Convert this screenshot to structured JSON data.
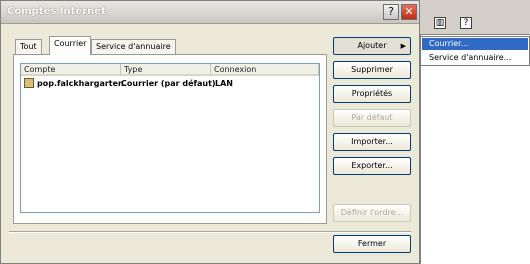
{
  "window": {
    "title": "Comptes Internet"
  },
  "tabs": [
    {
      "label": "Tout"
    },
    {
      "label": "Courrier"
    },
    {
      "label": "Service d'annuaire"
    }
  ],
  "list": {
    "columns": [
      "Compte",
      "Type",
      "Connexion"
    ],
    "rows": [
      {
        "account": "pop.falckhargarten.",
        "type": "Courrier (par défaut)",
        "connection": "LAN"
      }
    ]
  },
  "buttons": {
    "add": "Ajouter",
    "remove": "Supprimer",
    "properties": "Propriétés",
    "default": "Par défaut",
    "import": "Importer...",
    "export": "Exporter...",
    "order": "Définir l'ordre...",
    "close": "Fermer"
  },
  "menu": {
    "items": [
      "Courrier...",
      "Service d'annuaire..."
    ]
  },
  "colors": {
    "highlight": "#316ac5",
    "close_button": "#c22b12",
    "dialog_bg": "#ece9d8"
  }
}
